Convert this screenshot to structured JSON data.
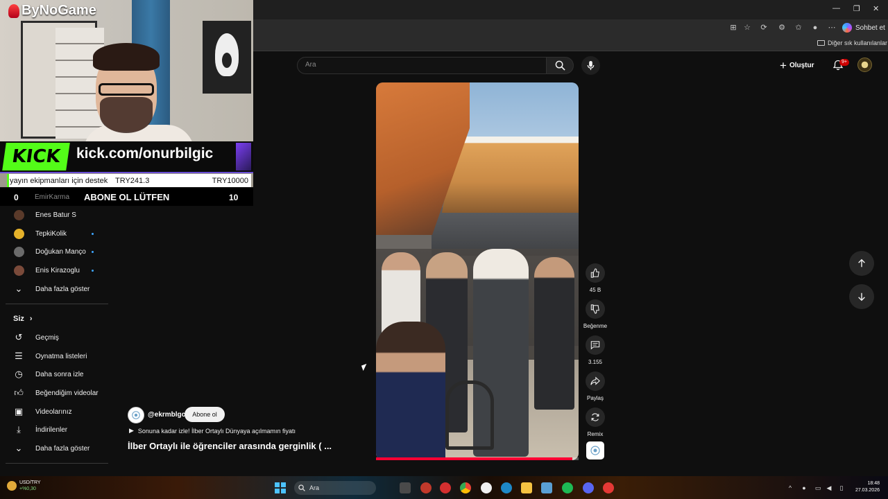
{
  "browser": {
    "chat_button_label": "Sohbet et",
    "bookmarks_other_label": "Diğer sık kullanılanlar",
    "window_controls": [
      "—",
      "❐",
      "✕"
    ]
  },
  "stream_overlay": {
    "channel_logo": "ByNoGame",
    "kick_logo": "KICK",
    "kick_url": "kick.com/onurbilgic",
    "donation_label": "yayın ekipmanları için destek",
    "donation_amount": "TRY241.3",
    "donation_goal": "TRY10000",
    "score_left": "0",
    "score_name": "EmirKarma",
    "score_title": "ABONE OL LÜTFEN",
    "score_right": "10"
  },
  "sidebar": {
    "subscriptions": [
      {
        "label": "Enes Batur S",
        "dot": false,
        "avatar_color": "#5a3a2a"
      },
      {
        "label": "TepkiKolik",
        "dot": true,
        "avatar_color": "#e4b12a"
      },
      {
        "label": "Doğukan Manço",
        "dot": true,
        "avatar_color": "#6b6b6b"
      },
      {
        "label": "Enis Kirazoglu",
        "dot": true,
        "avatar_color": "#7a4a3a"
      }
    ],
    "show_more_1": "Daha fazla göster",
    "you_header": "Siz",
    "you_items": [
      {
        "label": "Geçmiş",
        "icon": "history-icon"
      },
      {
        "label": "Oynatma listeleri",
        "icon": "playlists-icon"
      },
      {
        "label": "Daha sonra izle",
        "icon": "clock-icon"
      },
      {
        "label": "Beğendiğim videolar",
        "icon": "thumbs-up-icon"
      },
      {
        "label": "Videolarınız",
        "icon": "your-videos-icon"
      },
      {
        "label": "İndirilenler",
        "icon": "download-icon"
      }
    ],
    "show_more_2": "Daha fazla göster"
  },
  "header": {
    "search_placeholder": "Ara",
    "create_label": "Oluştur",
    "notification_badge": "9+"
  },
  "short": {
    "progress": 0.97,
    "like_count": "45 B",
    "dislike_label": "Beğenme",
    "comment_count": "3.155",
    "share_label": "Paylaş",
    "remix_label": "Remix",
    "channel_handle": "@ekrmblgc",
    "subscribe_label": "Abone ol",
    "playlist_text": "Sonuna kadar izle! İlber Ortaylı Dünyaya açılmamın fiyatı",
    "title": "İlber Ortaylı ile öğrenciler arasında gerginlik ( ..."
  },
  "taskbar": {
    "ticker_symbol": "USD/TRY",
    "ticker_change": "+%0,30",
    "search_label": "Ara",
    "time": "18:48",
    "date": "27.03.2026",
    "colors": {
      "accent": "#4cc2ff"
    }
  }
}
